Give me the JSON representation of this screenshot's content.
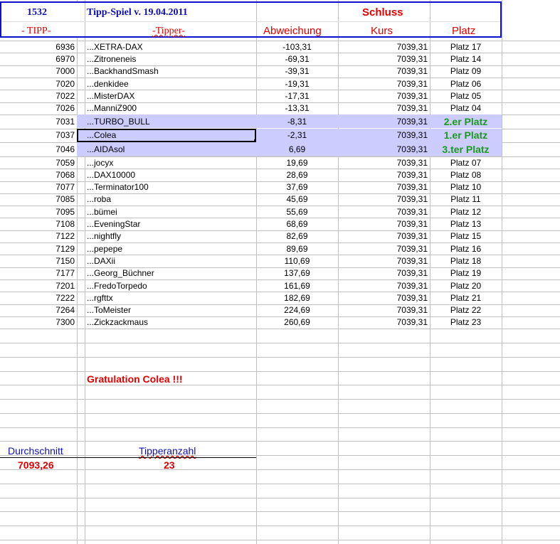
{
  "header": {
    "id": "1532",
    "title": "Tipp-Spiel v. 19.04.2011",
    "schluss": "Schluss",
    "col_tipp": "- TIPP-",
    "col_tipper": "-Tipper-",
    "col_abweichung": "Abweichung",
    "col_kurs": "Kurs",
    "col_platz": "Platz"
  },
  "rows": [
    {
      "tipp": "6936",
      "tipper": "...XETRA-DAX",
      "abw": "-103,31",
      "kurs": "7039,31",
      "platz": "Platz 17"
    },
    {
      "tipp": "6970",
      "tipper": "...Zitroneneis",
      "abw": "-69,31",
      "kurs": "7039,31",
      "platz": "Platz 14"
    },
    {
      "tipp": "7000",
      "tipper": "...BackhandSmash",
      "abw": "-39,31",
      "kurs": "7039,31",
      "platz": "Platz 09"
    },
    {
      "tipp": "7020",
      "tipper": "...denkidee",
      "abw": "-19,31",
      "kurs": "7039,31",
      "platz": "Platz 06"
    },
    {
      "tipp": "7022",
      "tipper": "...MisterDAX",
      "abw": "-17,31",
      "kurs": "7039,31",
      "platz": "Platz 05"
    },
    {
      "tipp": "7026",
      "tipper": "...ManniZ900",
      "abw": "-13,31",
      "kurs": "7039,31",
      "platz": "Platz 04"
    },
    {
      "tipp": "7031",
      "tipper": "...TURBO_BULL",
      "abw": "-8,31",
      "kurs": "7039,31",
      "platz": "2.er Platz",
      "winner": true
    },
    {
      "tipp": "7037",
      "tipper": "...Colea",
      "abw": "-2,31",
      "kurs": "7039,31",
      "platz": "1.er Platz",
      "winner": true,
      "selected": true
    },
    {
      "tipp": "7046",
      "tipper": "...AIDAsol",
      "abw": "6,69",
      "kurs": "7039,31",
      "platz": "3.ter Platz",
      "winner": true
    },
    {
      "tipp": "7059",
      "tipper": "...jocyx",
      "abw": "19,69",
      "kurs": "7039,31",
      "platz": "Platz 07"
    },
    {
      "tipp": "7068",
      "tipper": "...DAX10000",
      "abw": "28,69",
      "kurs": "7039,31",
      "platz": "Platz 08"
    },
    {
      "tipp": "7077",
      "tipper": "...Terminator100",
      "abw": "37,69",
      "kurs": "7039,31",
      "platz": "Platz 10"
    },
    {
      "tipp": "7085",
      "tipper": "...roba",
      "abw": "45,69",
      "kurs": "7039,31",
      "platz": "Platz 11"
    },
    {
      "tipp": "7095",
      "tipper": "...bümei",
      "abw": "55,69",
      "kurs": "7039,31",
      "platz": "Platz 12"
    },
    {
      "tipp": "7108",
      "tipper": "...EveningStar",
      "abw": "68,69",
      "kurs": "7039,31",
      "platz": "Platz 13"
    },
    {
      "tipp": "7122",
      "tipper": "...nightfly",
      "abw": "82,69",
      "kurs": "7039,31",
      "platz": "Platz 15"
    },
    {
      "tipp": "7129",
      "tipper": "...pepepe",
      "abw": "89,69",
      "kurs": "7039,31",
      "platz": "Platz 16"
    },
    {
      "tipp": "7150",
      "tipper": "...DAXii",
      "abw": "110,69",
      "kurs": "7039,31",
      "platz": "Platz 18"
    },
    {
      "tipp": "7177",
      "tipper": "...Georg_Büchner",
      "abw": "137,69",
      "kurs": "7039,31",
      "platz": "Platz 19"
    },
    {
      "tipp": "7201",
      "tipper": "...FredoTorpedo",
      "abw": "161,69",
      "kurs": "7039,31",
      "platz": "Platz 20"
    },
    {
      "tipp": "7222",
      "tipper": "...rgfttx",
      "abw": "182,69",
      "kurs": "7039,31",
      "platz": "Platz 21"
    },
    {
      "tipp": "7264",
      "tipper": "...ToMeister",
      "abw": "224,69",
      "kurs": "7039,31",
      "platz": "Platz 22"
    },
    {
      "tipp": "7300",
      "tipper": "...Zickzackmaus",
      "abw": "260,69",
      "kurs": "7039,31",
      "platz": "Platz 23"
    }
  ],
  "footer": {
    "gratulation": "Gratulation Colea !!!",
    "durchschnitt_label": "Durchschnitt",
    "durchschnitt_value": "7093,26",
    "tipperanzahl_label": "Tipperanzahl",
    "tipperanzahl_value": "23"
  }
}
